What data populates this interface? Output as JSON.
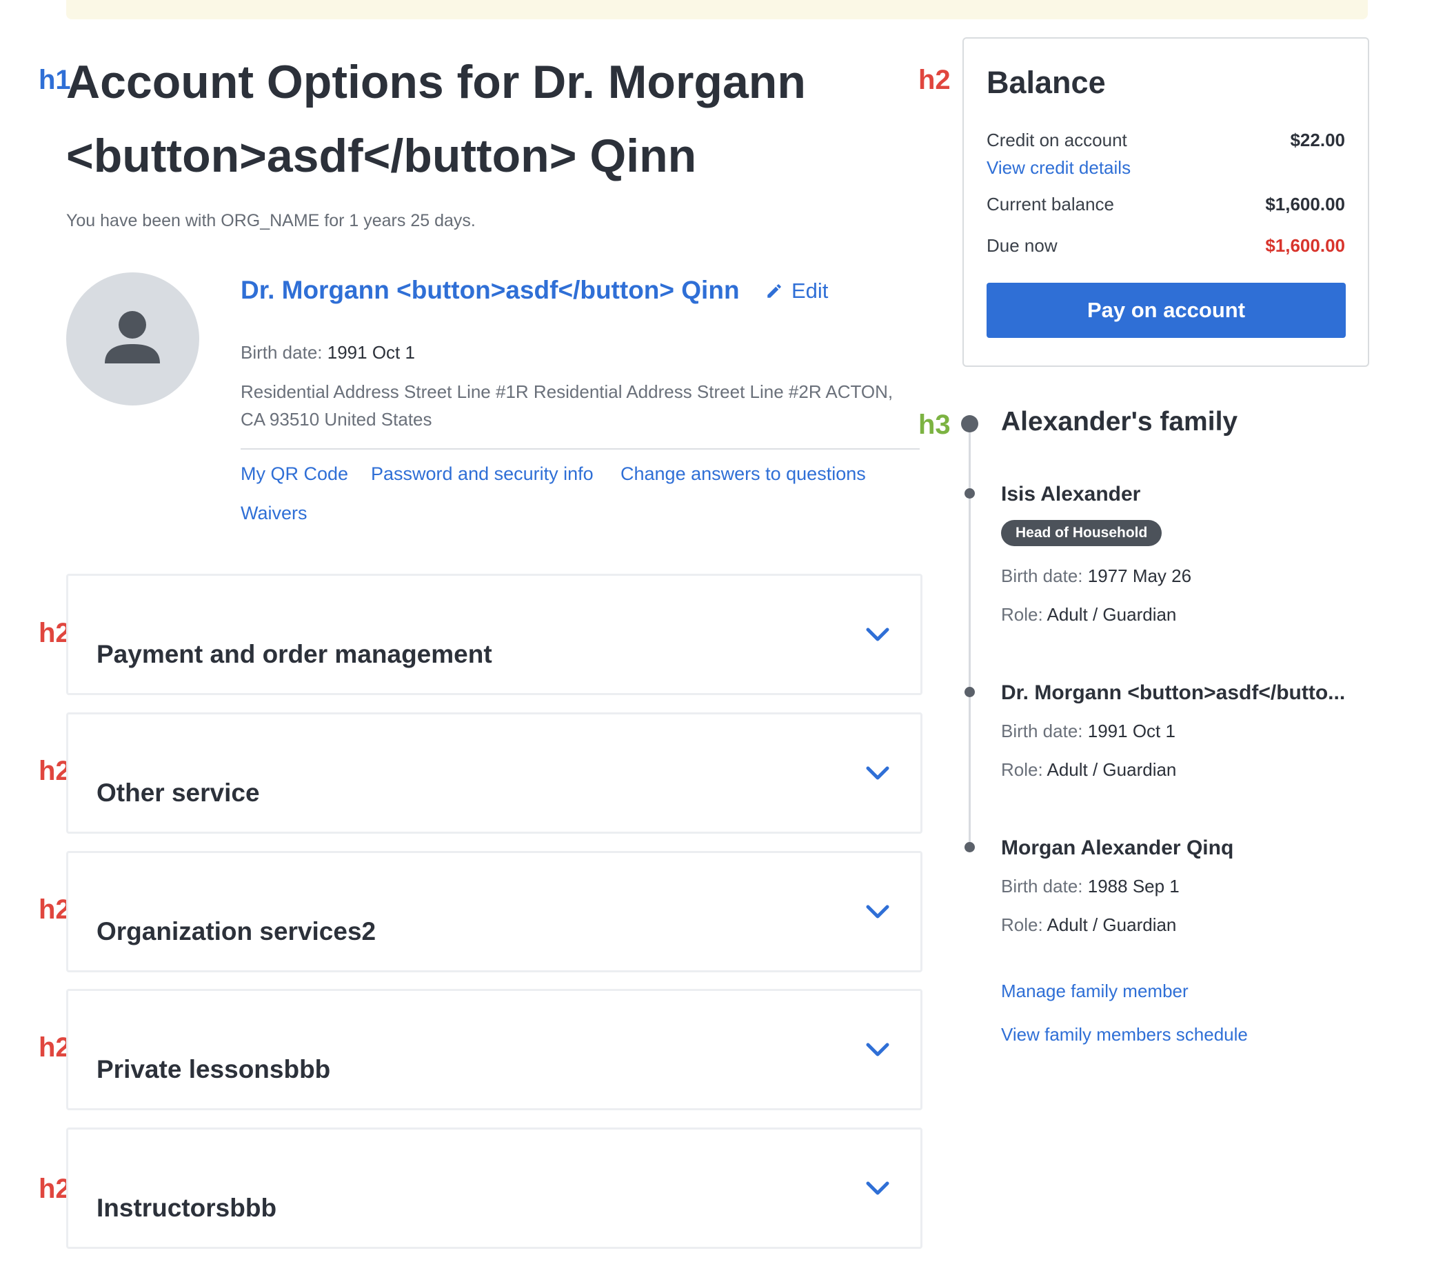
{
  "annotations": {
    "h1": "h1",
    "h2": "h2",
    "h3": "h3"
  },
  "header": {
    "title": "Account Options for Dr. Morgann <button>asdf</button> Qinn",
    "tenure": "You have been with ORG_NAME for 1 years 25 days."
  },
  "profile": {
    "avatar_icon": "user-icon",
    "name": "Dr. Morgann <button>asdf</button> Qinn",
    "edit_label": "Edit",
    "birth_label": "Birth date:",
    "birth_value": "1991 Oct 1",
    "address": "Residential Address Street Line #1R Residential Address Street Line #2R ACTON, CA 93510 United States",
    "links": [
      "My QR Code",
      "Password and security info",
      "Change answers to questions",
      "Waivers"
    ]
  },
  "sections": [
    "Payment and order management",
    "Other service",
    "Organization services2",
    "Private lessonsbbb",
    "Instructorsbbb"
  ],
  "balance": {
    "title": "Balance",
    "credit_label": "Credit on account",
    "credit_value": "$22.00",
    "credit_link": "View credit details",
    "current_label": "Current balance",
    "current_value": "$1,600.00",
    "due_label": "Due now",
    "due_value": "$1,600.00",
    "due_color": "#d8342c",
    "pay_button": "Pay on account",
    "accent": "#2f6fd6"
  },
  "family": {
    "title": "Alexander's family",
    "birth_label": "Birth date:",
    "role_label": "Role:",
    "members": [
      {
        "name": "Isis Alexander",
        "badge": "Head of Household",
        "birth": "1977 May 26",
        "role": "Adult / Guardian"
      },
      {
        "name": "Dr. Morgann <button>asdf</butto...",
        "birth": "1991 Oct 1",
        "role": "Adult / Guardian"
      },
      {
        "name": "Morgan Alexander Qinq",
        "birth": "1988 Sep 1",
        "role": "Adult / Guardian"
      }
    ],
    "links": [
      "Manage family member",
      "View family members schedule"
    ]
  }
}
